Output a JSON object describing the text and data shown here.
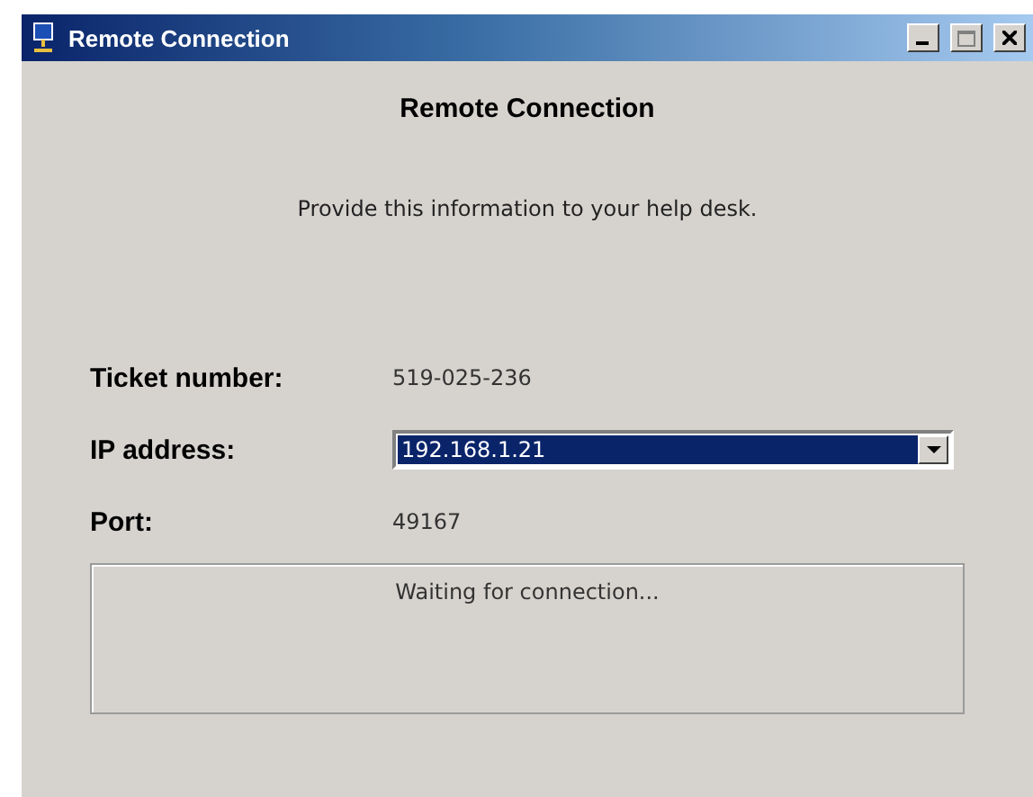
{
  "window": {
    "title": "Remote Connection"
  },
  "heading": "Remote Connection",
  "instruction": "Provide this information to your help desk.",
  "fields": [
    {
      "kind": "text",
      "label": "Ticket number:",
      "value": "519-025-236"
    },
    {
      "kind": "dropdown",
      "label": "IP address:",
      "value": "192.168.1.21",
      "selected": true
    },
    {
      "kind": "text",
      "label": "Port:",
      "value": "49167"
    }
  ],
  "status": "Waiting for connection..."
}
